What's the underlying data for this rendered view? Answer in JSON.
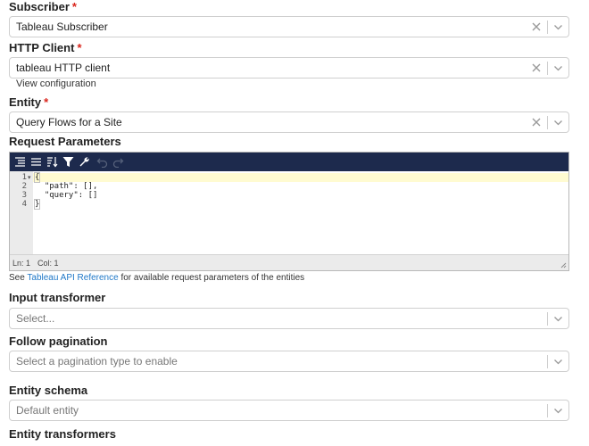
{
  "subscriber": {
    "label": "Subscriber",
    "required_mark": "*",
    "value": "Tableau Subscriber"
  },
  "http_client": {
    "label": "HTTP Client",
    "required_mark": "*",
    "value": "tableau HTTP client",
    "view_link": "View configuration"
  },
  "entity": {
    "label": "Entity",
    "required_mark": "*",
    "value": "Query Flows for a Site"
  },
  "request_parameters": {
    "label": "Request Parameters",
    "toolbar": {
      "icons": [
        "format-icon",
        "compact-icon",
        "sort-icon",
        "filter-icon",
        "repair-icon",
        "undo-icon",
        "redo-icon"
      ]
    },
    "line_numbers": [
      "1",
      "2",
      "3",
      "4"
    ],
    "code_lines": [
      "{",
      "  \"path\": [],",
      "  \"query\": []",
      "}"
    ],
    "status": {
      "ln": "Ln: 1",
      "col": "Col: 1"
    },
    "colors": {
      "toolbar_bg": "#1d2a4d",
      "active_line": "#fffbd1"
    }
  },
  "help": {
    "prefix": "See ",
    "link": "Tableau API Reference",
    "suffix": " for available request parameters of the entities",
    "link_color": "#1f78c8"
  },
  "input_transformer": {
    "label": "Input transformer",
    "placeholder": "Select..."
  },
  "follow_pagination": {
    "label": "Follow pagination",
    "placeholder": "Select a pagination type to enable"
  },
  "entity_schema": {
    "label": "Entity schema",
    "placeholder": "Default entity"
  },
  "entity_transformers": {
    "label": "Entity transformers"
  }
}
